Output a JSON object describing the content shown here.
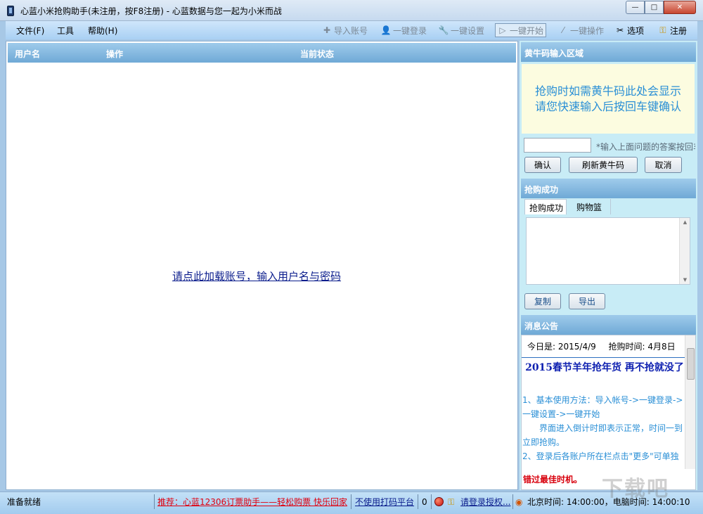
{
  "window": {
    "title": "心蓝小米抢购助手(未注册，按F8注册) - 心蓝数据与您一起为小米而战",
    "minimize_glyph": "—",
    "maximize_glyph": "□",
    "close_glyph": "✕"
  },
  "menu": {
    "file": "文件(F)",
    "tools": "工具",
    "help": "帮助(H)"
  },
  "toolbar": {
    "import": "导入账号",
    "login": "一键登录",
    "settings": "一键设置",
    "start": "一键开始",
    "operate": "一键操作",
    "options": "选项",
    "register": "注册",
    "icons": {
      "import": "plus-icon",
      "login": "user-icon",
      "settings": "wrench-icon",
      "start": "play-icon",
      "operate": "wand-icon",
      "options": "tools-icon",
      "register": "key-icon"
    }
  },
  "grid": {
    "col_username": "用户名",
    "col_action": "操作",
    "col_status": "当前状态",
    "load_link": "请点此加载账号，输入用户名与密码"
  },
  "scalper": {
    "heading": "黄牛码输入区域",
    "prompt_line1": "抢购时如需黄牛码此处会显示",
    "prompt_line2": "请您快速输入后按回车键确认",
    "input_value": "",
    "hint": "*输入上面问题的答案按回车",
    "confirm": "确认",
    "refresh": "刷新黄牛码",
    "cancel": "取消"
  },
  "success": {
    "heading": "抢购成功",
    "tab_success": "抢购成功",
    "tab_cart": "购物篮",
    "copy": "复制",
    "export": "导出"
  },
  "notice": {
    "heading": "消息公告",
    "today_label": "今日是:",
    "today_value": "2015/4/9",
    "buy_time_label": "抢购时间:",
    "buy_time_value": "4月8日",
    "title": "2015春节羊年抢年货 再不抢就没了",
    "body": [
      "1、基本使用方法：导入帐号->一键登录->一键设置->一键开始",
      "界面进入倒计时即表示正常，时间一到立即抢购。",
      "2、登录后各账户所在栏点击\"更多\"可单独"
    ],
    "footer_red": "错过最佳时机。"
  },
  "status": {
    "ready": "准备就绪",
    "promo": "推荐：心蓝12306订票助手——轻松购票 快乐回家",
    "captcha": "不使用打码平台",
    "count": "0",
    "auth": "请登录授权...",
    "time": "北京时间: 14:00:00，电脑时间: 14:00:10"
  },
  "watermark": "下载吧"
}
